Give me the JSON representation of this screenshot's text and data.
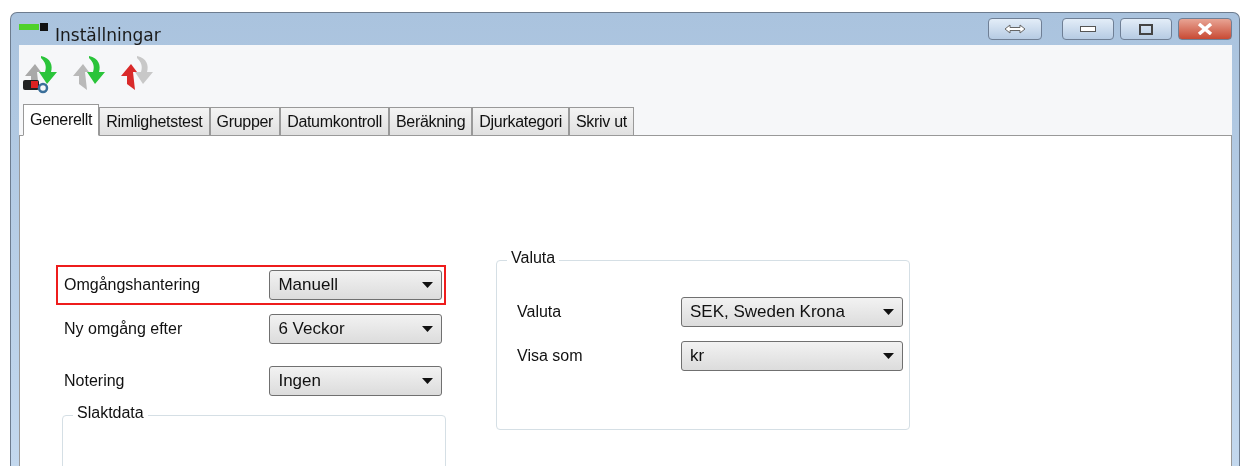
{
  "window": {
    "title": "Inställningar"
  },
  "tabs": [
    {
      "label": "Generellt",
      "selected": true
    },
    {
      "label": "Rimlighetstest",
      "selected": false
    },
    {
      "label": "Grupper",
      "selected": false
    },
    {
      "label": "Datumkontroll",
      "selected": false
    },
    {
      "label": "Beräkning",
      "selected": false
    },
    {
      "label": "Djurkategori",
      "selected": false
    },
    {
      "label": "Skriv ut",
      "selected": false
    }
  ],
  "settings": [
    {
      "label": "Omgångshantering",
      "value": "Manuell",
      "highlighted": true
    },
    {
      "label": "Ny omgång efter",
      "value": "6 Veckor",
      "highlighted": false
    },
    {
      "label": "Notering",
      "value": "Ingen",
      "highlighted": false
    }
  ],
  "slaktdata": {
    "title": "Slaktdata"
  },
  "valuta": {
    "title": "Valuta",
    "fields": [
      {
        "label": "Valuta",
        "value": "SEK, Sweden Krona"
      },
      {
        "label": "Visa som",
        "value": "kr"
      }
    ]
  }
}
